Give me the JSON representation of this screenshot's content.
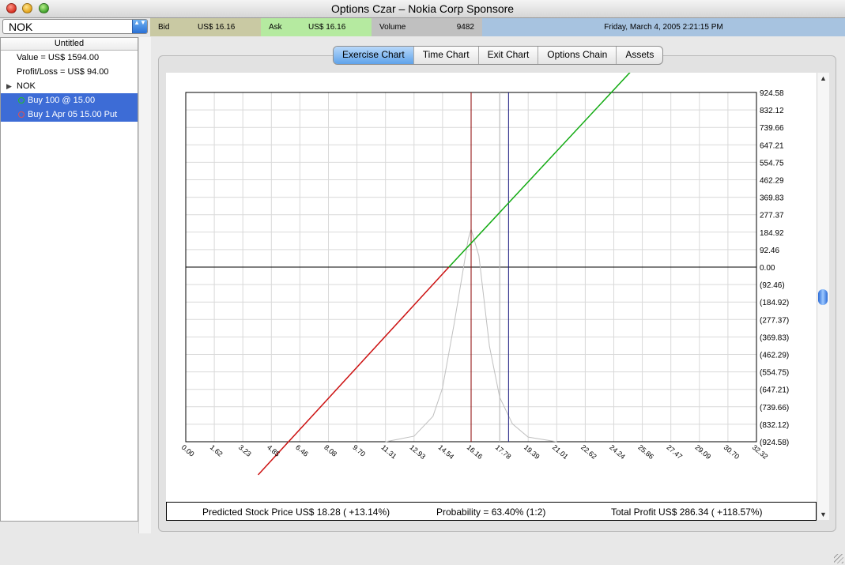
{
  "window": {
    "title": "Options Czar –  Nokia Corp Sponsore"
  },
  "symbol_select": {
    "value": "NOK",
    "arrow_glyph": "▲▼"
  },
  "quote": {
    "bid_label": "Bid",
    "bid_value": "US$ 16.16",
    "ask_label": "Ask",
    "ask_value": "US$ 16.16",
    "volume_label": "Volume",
    "volume_value": "9482",
    "datetime": "Friday, March 4, 2005 2:21:15 PM",
    "colors": {
      "bid": "#c9c9a3",
      "ask": "#b5eaa0",
      "volume": "#c0c0c0",
      "date": "#a7c3e0"
    }
  },
  "sidebar": {
    "header": "Untitled",
    "value": "Value = US$ 1594.00",
    "profit_loss": "Profit/Loss = US$ 94.00",
    "symbol": "NOK",
    "positions": [
      {
        "label": "Buy 100 @ 15.00",
        "icon": "green-circle-icon"
      },
      {
        "label": "Buy 1 Apr 05 15.00 Put",
        "icon": "red-circle-icon"
      }
    ]
  },
  "tabs": [
    "Exercise Chart",
    "Time Chart",
    "Exit Chart",
    "Options Chain",
    "Assets"
  ],
  "active_tab": "Exercise Chart",
  "status": {
    "predicted": "Predicted Stock Price US$ 18.28 ( +13.14%)",
    "probability": "Probability = 63.40% (1:2)",
    "total_profit": "Total Profit US$ 286.34 ( +118.57%)"
  },
  "chart_data": {
    "type": "line",
    "xlim": [
      0,
      32.32
    ],
    "ylim": [
      -924.58,
      924.58
    ],
    "x_tick_labels": [
      "0.00",
      "1.62",
      "3.23",
      "4.85",
      "6.46",
      "8.08",
      "9.70",
      "11.31",
      "12.93",
      "14.54",
      "16.16",
      "17.78",
      "19.39",
      "21.01",
      "22.62",
      "24.24",
      "25.86",
      "27.47",
      "29.09",
      "30.70",
      "32.32"
    ],
    "y_tick_labels": [
      "924.58",
      "832.12",
      "739.66",
      "647.21",
      "554.75",
      "462.29",
      "369.83",
      "277.37",
      "184.92",
      "92.46",
      "0.00",
      "(92.46)",
      "(184.92)",
      "(277.37)",
      "(369.83)",
      "(462.29)",
      "(554.75)",
      "(647.21)",
      "(739.66)",
      "(832.12)",
      "(924.58)"
    ],
    "grid": true,
    "series": [
      {
        "color": "#cc1111",
        "x": [
          4.1,
          14.9
        ],
        "y": [
          -1100,
          0
        ]
      },
      {
        "color": "#11aa11",
        "x": [
          14.9,
          25.2
        ],
        "y": [
          0,
          1035
        ]
      }
    ],
    "distribution_curve": {
      "color": "#bfbfbf",
      "x": [
        11.31,
        12.93,
        14.0,
        14.54,
        15.2,
        16.0,
        16.16,
        16.6,
        17.2,
        17.78,
        18.5,
        19.39,
        21.01
      ],
      "y": [
        -924.58,
        -895,
        -790,
        -640,
        -300,
        150,
        200,
        60,
        -420,
        -690,
        -830,
        -900,
        -924.58
      ]
    },
    "vertical_markers": [
      {
        "x": 16.16,
        "color": "#8b0000"
      },
      {
        "x": 17.78,
        "color": "#b8b8b8"
      },
      {
        "x": 18.28,
        "color": "#1a1a80"
      }
    ]
  }
}
